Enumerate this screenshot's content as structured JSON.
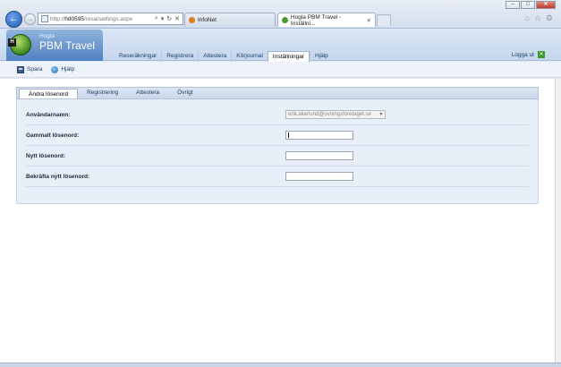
{
  "browser": {
    "address": {
      "prefix": "http://",
      "host": "hd0595",
      "path": "/resa/settings.aspx"
    },
    "tabs": [
      {
        "label": "InfoNet",
        "active": false
      },
      {
        "label": "Hogia PBM Travel - Inställni...",
        "active": true
      }
    ]
  },
  "brand": {
    "company": "Hogia",
    "product": "PBM Travel"
  },
  "nav": {
    "items": [
      "Reseräkningar",
      "Registrera",
      "Attestera",
      "Körjournal",
      "Inställningar",
      "Hjälp"
    ],
    "active": "Inställningar",
    "logout_label": "Logga ut"
  },
  "toolbar": {
    "save_label": "Spara",
    "help_label": "Hjälp"
  },
  "subtabs": {
    "items": [
      "Ändra lösenord",
      "Registrering",
      "Attestera",
      "Övrigt"
    ],
    "active": "Ändra lösenord"
  },
  "form": {
    "username_label": "Användarnamn:",
    "username_value": "erik.akerlund@ovningsforetaget.se",
    "old_password_label": "Gammalt lösenord:",
    "new_password_label": "Nytt lösenord:",
    "confirm_password_label": "Bekräfta nytt lösenord:"
  },
  "colors": {
    "accent": "#4f80c0",
    "nav_text": "#1b3c6a",
    "panel_bg": "#e9eff8"
  }
}
